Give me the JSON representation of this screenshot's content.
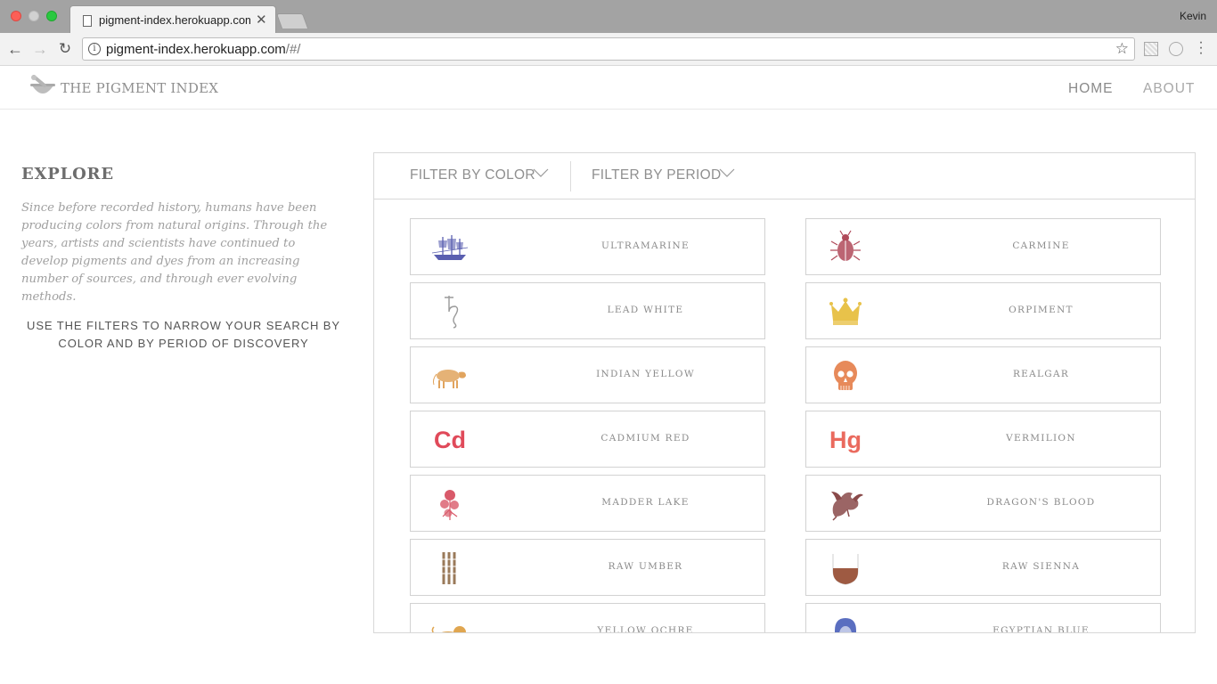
{
  "browser": {
    "tab_title": "pigment-index.herokuapp.com",
    "tab_close": "✕",
    "profile_name": "Kevin",
    "url_host": "pigment-index.herokuapp.com",
    "url_path": "/#/"
  },
  "site": {
    "logo_text": "THE PIGMENT INDEX",
    "nav": {
      "home": "HOME",
      "about": "ABOUT"
    }
  },
  "explore": {
    "title": "EXPLORE",
    "description": "Since before recorded history, humans have been producing colors from natural origins. Through the years, artists and scientists have continued to develop pigments and dyes from an increasing number of sources, and through ever evolving methods.",
    "cta": "USE THE FILTERS TO NARROW YOUR SEARCH BY COLOR AND BY PERIOD OF DISCOVERY"
  },
  "filters": {
    "color": "FILTER BY COLOR",
    "period": "FILTER BY PERIOD"
  },
  "pigments": [
    {
      "name": "ULTRAMARINE",
      "icon": "ship-icon",
      "color": "#5a5fb0"
    },
    {
      "name": "CARMINE",
      "icon": "beetle-icon",
      "color": "#b04a5a"
    },
    {
      "name": "LEAD WHITE",
      "icon": "saturn-symbol-icon",
      "color": "#9a9a9a"
    },
    {
      "name": "ORPIMENT",
      "icon": "crown-icon",
      "color": "#e8c24a"
    },
    {
      "name": "INDIAN YELLOW",
      "icon": "cow-icon",
      "color": "#e1a45e"
    },
    {
      "name": "REALGAR",
      "icon": "skull-icon",
      "color": "#e78a5a"
    },
    {
      "name": "CADMIUM RED",
      "icon": "cd-symbol-icon",
      "symbol": "Cd",
      "color": "#e04a5a"
    },
    {
      "name": "VERMILION",
      "icon": "hg-symbol-icon",
      "symbol": "Hg",
      "color": "#ea6a5e"
    },
    {
      "name": "MADDER LAKE",
      "icon": "madder-flower-icon",
      "color": "#d95a6a"
    },
    {
      "name": "DRAGON'S BLOOD",
      "icon": "dragon-icon",
      "color": "#8a4a4a"
    },
    {
      "name": "RAW UMBER",
      "icon": "reeds-icon",
      "color": "#9a7a5a"
    },
    {
      "name": "RAW SIENNA",
      "icon": "vessel-icon",
      "color": "#9e5a42"
    },
    {
      "name": "YELLOW OCHRE",
      "icon": "lion-icon",
      "color": "#e0a650"
    },
    {
      "name": "EGYPTIAN BLUE",
      "icon": "pharaoh-icon",
      "color": "#5a6ec0"
    }
  ]
}
